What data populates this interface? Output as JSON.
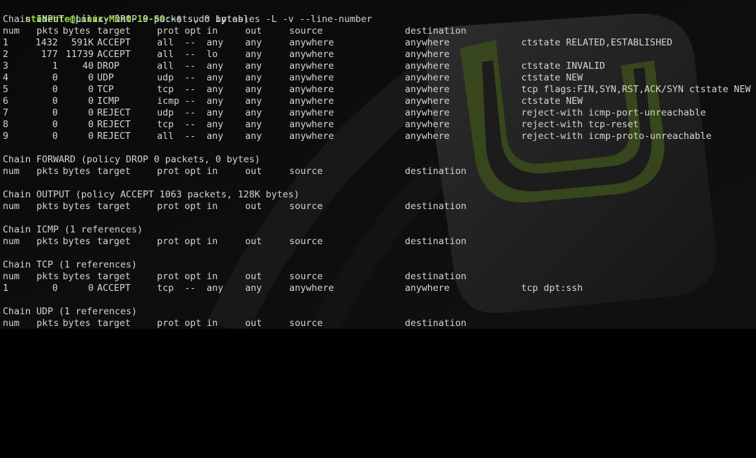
{
  "prompt": {
    "user_host": "studente@Linux-Mint-19-SO",
    "separator": ":",
    "path": "~",
    "symbol": "$",
    "command": " sudo iptables -L -v --line-number"
  },
  "header_labels": {
    "num": "num",
    "pkts": "pkts",
    "bytes": "bytes",
    "target": "target",
    "prot": "prot",
    "opt": "opt",
    "in": "in",
    "out": "out",
    "source": "source",
    "destination": "destination"
  },
  "chains": [
    {
      "title": "Chain INPUT (policy DROP 0 packets, 0 bytes)",
      "rules": [
        {
          "num": "1",
          "pkts": "1432",
          "bytes": "591K",
          "target": "ACCEPT",
          "prot": "all",
          "opt": "--",
          "in": "any",
          "out": "any",
          "source": "anywhere",
          "destination": "anywhere",
          "extra": "ctstate RELATED,ESTABLISHED"
        },
        {
          "num": "2",
          "pkts": "177",
          "bytes": "11739",
          "target": "ACCEPT",
          "prot": "all",
          "opt": "--",
          "in": "lo",
          "out": "any",
          "source": "anywhere",
          "destination": "anywhere",
          "extra": ""
        },
        {
          "num": "3",
          "pkts": "1",
          "bytes": "40",
          "target": "DROP",
          "prot": "all",
          "opt": "--",
          "in": "any",
          "out": "any",
          "source": "anywhere",
          "destination": "anywhere",
          "extra": "ctstate INVALID"
        },
        {
          "num": "4",
          "pkts": "0",
          "bytes": "0",
          "target": "UDP",
          "prot": "udp",
          "opt": "--",
          "in": "any",
          "out": "any",
          "source": "anywhere",
          "destination": "anywhere",
          "extra": "ctstate NEW"
        },
        {
          "num": "5",
          "pkts": "0",
          "bytes": "0",
          "target": "TCP",
          "prot": "tcp",
          "opt": "--",
          "in": "any",
          "out": "any",
          "source": "anywhere",
          "destination": "anywhere",
          "extra": "tcp flags:FIN,SYN,RST,ACK/SYN ctstate NEW"
        },
        {
          "num": "6",
          "pkts": "0",
          "bytes": "0",
          "target": "ICMP",
          "prot": "icmp",
          "opt": "--",
          "in": "any",
          "out": "any",
          "source": "anywhere",
          "destination": "anywhere",
          "extra": "ctstate NEW"
        },
        {
          "num": "7",
          "pkts": "0",
          "bytes": "0",
          "target": "REJECT",
          "prot": "udp",
          "opt": "--",
          "in": "any",
          "out": "any",
          "source": "anywhere",
          "destination": "anywhere",
          "extra": "reject-with icmp-port-unreachable"
        },
        {
          "num": "8",
          "pkts": "0",
          "bytes": "0",
          "target": "REJECT",
          "prot": "tcp",
          "opt": "--",
          "in": "any",
          "out": "any",
          "source": "anywhere",
          "destination": "anywhere",
          "extra": "reject-with tcp-reset"
        },
        {
          "num": "9",
          "pkts": "0",
          "bytes": "0",
          "target": "REJECT",
          "prot": "all",
          "opt": "--",
          "in": "any",
          "out": "any",
          "source": "anywhere",
          "destination": "anywhere",
          "extra": "reject-with icmp-proto-unreachable"
        }
      ]
    },
    {
      "title": "Chain FORWARD (policy DROP 0 packets, 0 bytes)",
      "rules": []
    },
    {
      "title": "Chain OUTPUT (policy ACCEPT 1063 packets, 128K bytes)",
      "rules": []
    },
    {
      "title": "Chain ICMP (1 references)",
      "rules": []
    },
    {
      "title": "Chain TCP (1 references)",
      "rules": [
        {
          "num": "1",
          "pkts": "0",
          "bytes": "0",
          "target": "ACCEPT",
          "prot": "tcp",
          "opt": "--",
          "in": "any",
          "out": "any",
          "source": "anywhere",
          "destination": "anywhere",
          "extra": "tcp dpt:ssh"
        }
      ]
    },
    {
      "title": "Chain UDP (1 references)",
      "rules": []
    }
  ],
  "colors": {
    "text": "#d3d7cf",
    "prompt_user": "#8ae234",
    "prompt_path": "#729fcf",
    "background": "#000000",
    "logo_green": "#3a4a1c"
  },
  "background_icon": "linux-mint-logo"
}
